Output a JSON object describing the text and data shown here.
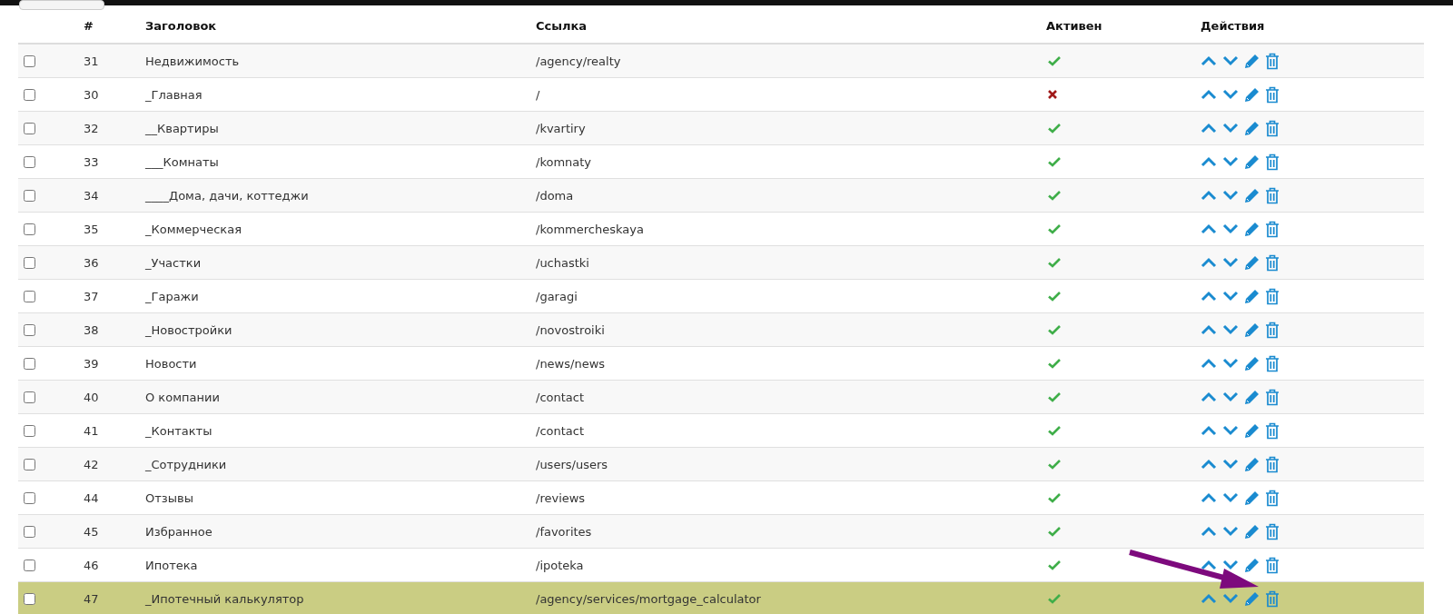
{
  "table": {
    "columns": [
      "#",
      "Заголовок",
      "Ссылка",
      "Активен",
      "Действия"
    ],
    "rows": [
      {
        "id": "31",
        "title": "Недвижимость",
        "link": "/agency/realty",
        "active": true,
        "checked": false,
        "selected": false
      },
      {
        "id": "30",
        "title": "_Главная",
        "link": "/",
        "active": false,
        "checked": false,
        "selected": false
      },
      {
        "id": "32",
        "title": "__Квартиры",
        "link": "/kvartiry",
        "active": true,
        "checked": false,
        "selected": false
      },
      {
        "id": "33",
        "title": "___Комнаты",
        "link": "/komnaty",
        "active": true,
        "checked": false,
        "selected": false
      },
      {
        "id": "34",
        "title": "____Дома, дачи, коттеджи",
        "link": "/doma",
        "active": true,
        "checked": false,
        "selected": false
      },
      {
        "id": "35",
        "title": "_Коммерческая",
        "link": "/kommercheskaya",
        "active": true,
        "checked": false,
        "selected": false
      },
      {
        "id": "36",
        "title": "_Участки",
        "link": "/uchastki",
        "active": true,
        "checked": false,
        "selected": false
      },
      {
        "id": "37",
        "title": "_Гаражи",
        "link": "/garagi",
        "active": true,
        "checked": false,
        "selected": false
      },
      {
        "id": "38",
        "title": "_Новостройки",
        "link": "/novostroiki",
        "active": true,
        "checked": false,
        "selected": false
      },
      {
        "id": "39",
        "title": "Новости",
        "link": "/news/news",
        "active": true,
        "checked": false,
        "selected": false
      },
      {
        "id": "40",
        "title": "О компании",
        "link": "/contact",
        "active": true,
        "checked": false,
        "selected": false
      },
      {
        "id": "41",
        "title": "_Контакты",
        "link": "/contact",
        "active": true,
        "checked": false,
        "selected": false
      },
      {
        "id": "42",
        "title": "_Сотрудники",
        "link": "/users/users",
        "active": true,
        "checked": false,
        "selected": false
      },
      {
        "id": "44",
        "title": "Отзывы",
        "link": "/reviews",
        "active": true,
        "checked": false,
        "selected": false
      },
      {
        "id": "45",
        "title": "Избранное",
        "link": "/favorites",
        "active": true,
        "checked": false,
        "selected": false
      },
      {
        "id": "46",
        "title": "Ипотека",
        "link": "/ipoteka",
        "active": true,
        "checked": false,
        "selected": false
      },
      {
        "id": "47",
        "title": "_Ипотечный калькулятор",
        "link": "/agency/services/mortgage_calculator",
        "active": true,
        "checked": false,
        "selected": true
      }
    ]
  }
}
